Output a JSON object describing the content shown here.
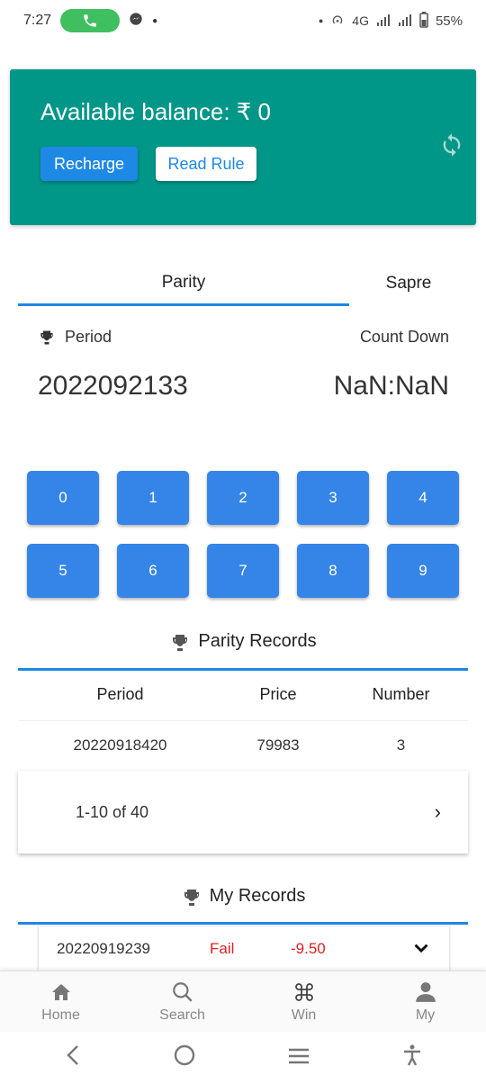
{
  "status_bar": {
    "time": "7:27",
    "network": "4G",
    "battery": "55%"
  },
  "balance": {
    "title": "Available balance: ₹ 0",
    "recharge_label": "Recharge",
    "read_rule_label": "Read Rule"
  },
  "tabs": [
    {
      "label": "Parity",
      "active": true
    },
    {
      "label": "Sapre",
      "active": false
    }
  ],
  "period": {
    "label": "Period",
    "value": "2022092133",
    "countdown_label": "Count Down",
    "countdown_value": "NaN:NaN"
  },
  "numbers": [
    "0",
    "1",
    "2",
    "3",
    "4",
    "5",
    "6",
    "7",
    "8",
    "9"
  ],
  "parity_records": {
    "title": "Parity Records",
    "headers": {
      "period": "Period",
      "price": "Price",
      "number": "Number"
    },
    "rows": [
      {
        "period": "20220918420",
        "price": "79983",
        "number": "3"
      }
    ],
    "pagination": "1-10 of 40",
    "next_label": "›"
  },
  "my_records": {
    "title": "My Records",
    "rows": [
      {
        "period": "20220919239",
        "status": "Fail",
        "amount": "-9.50"
      }
    ]
  },
  "bottom_nav": [
    {
      "label": "Home",
      "icon": "home-icon"
    },
    {
      "label": "Search",
      "icon": "search-icon"
    },
    {
      "label": "Win",
      "icon": "command-icon"
    },
    {
      "label": "My",
      "icon": "person-icon"
    }
  ],
  "colors": {
    "balance_card": "#009688",
    "primary": "#1e88e5",
    "number_button": "#3585e8",
    "fail": "#e02020"
  }
}
